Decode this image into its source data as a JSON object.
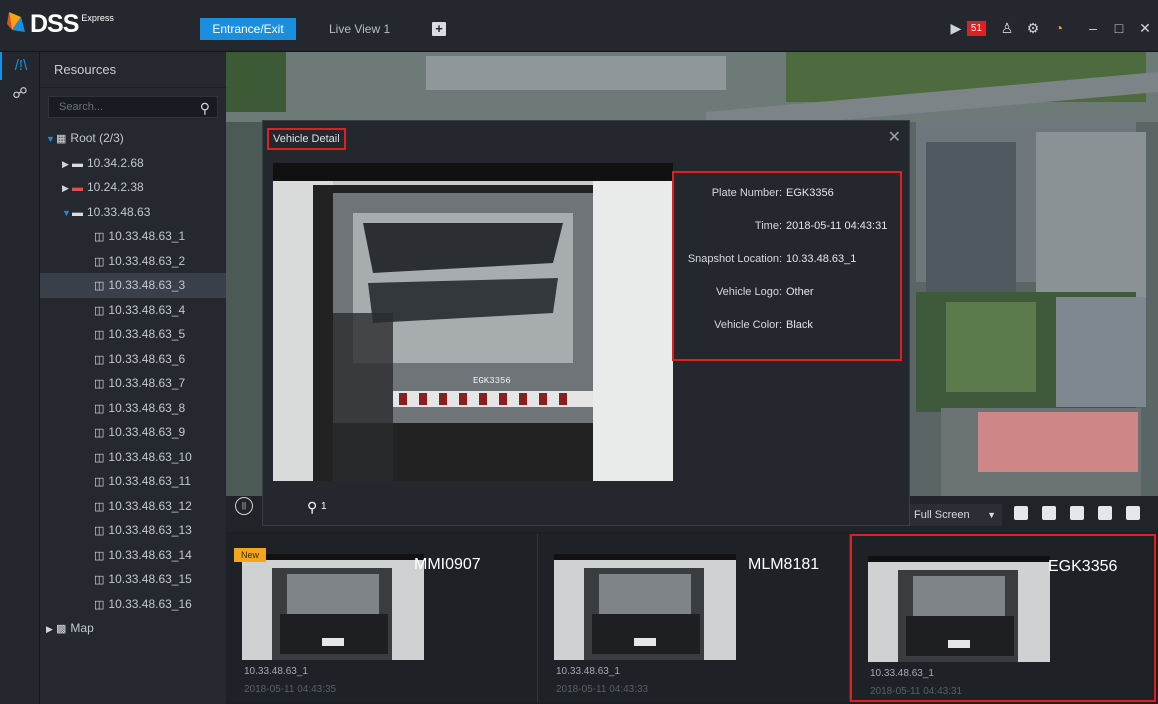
{
  "app": {
    "brand": "DSS",
    "edition": "Express"
  },
  "tabs": [
    {
      "label": "Entrance/Exit"
    },
    {
      "label": "Live View 1"
    }
  ],
  "topbar": {
    "alarm_count": "51"
  },
  "sidebar": {
    "title": "Resources",
    "search_placeholder": "Search...",
    "tree": [
      {
        "label": "Root (2/3)",
        "level": 0,
        "expanded": true,
        "icon": "org-icon"
      },
      {
        "label": "10.34.2.68",
        "level": 1,
        "expanded": false,
        "icon": "device-icon"
      },
      {
        "label": "10.24.2.38",
        "level": 1,
        "expanded": false,
        "icon": "device-offline-icon"
      },
      {
        "label": "10.33.48.63",
        "level": 1,
        "expanded": true,
        "icon": "device-icon"
      },
      {
        "label": "10.33.48.63_1",
        "level": 2,
        "icon": "camera-icon"
      },
      {
        "label": "10.33.48.63_2",
        "level": 2,
        "icon": "camera-icon"
      },
      {
        "label": "10.33.48.63_3",
        "level": 2,
        "icon": "camera-icon",
        "selected": true
      },
      {
        "label": "10.33.48.63_4",
        "level": 2,
        "icon": "camera-icon"
      },
      {
        "label": "10.33.48.63_5",
        "level": 2,
        "icon": "camera-icon"
      },
      {
        "label": "10.33.48.63_6",
        "level": 2,
        "icon": "camera-icon"
      },
      {
        "label": "10.33.48.63_7",
        "level": 2,
        "icon": "camera-icon"
      },
      {
        "label": "10.33.48.63_8",
        "level": 2,
        "icon": "camera-icon"
      },
      {
        "label": "10.33.48.63_9",
        "level": 2,
        "icon": "camera-icon"
      },
      {
        "label": "10.33.48.63_10",
        "level": 2,
        "icon": "camera-icon"
      },
      {
        "label": "10.33.48.63_11",
        "level": 2,
        "icon": "camera-icon"
      },
      {
        "label": "10.33.48.63_12",
        "level": 2,
        "icon": "camera-icon"
      },
      {
        "label": "10.33.48.63_13",
        "level": 2,
        "icon": "camera-icon"
      },
      {
        "label": "10.33.48.63_14",
        "level": 2,
        "icon": "camera-icon"
      },
      {
        "label": "10.33.48.63_15",
        "level": 2,
        "icon": "camera-icon"
      },
      {
        "label": "10.33.48.63_16",
        "level": 2,
        "icon": "camera-icon"
      },
      {
        "label": "Map",
        "level": 0,
        "expanded": false,
        "icon": "map-icon"
      }
    ]
  },
  "dialog": {
    "title": "Vehicle Detail",
    "snapshot_plate_text": "EGK3356",
    "fields": [
      {
        "label": "Plate Number:",
        "value": "EGK3356"
      },
      {
        "label": "Time:",
        "value": "2018-05-11 04:43:31"
      },
      {
        "label": "Snapshot Location:",
        "value": "10.33.48.63_1"
      },
      {
        "label": "Vehicle Logo:",
        "value": "Other"
      },
      {
        "label": "Vehicle Color:",
        "value": "Black"
      }
    ],
    "pin_count": "1"
  },
  "view_controls": {
    "fullscreen_label": "Full Screen"
  },
  "captures": [
    {
      "plate": "MMI0907",
      "location": "10.33.48.63_1",
      "time": "2018-05-11 04:43:35",
      "new": true,
      "new_label": "New",
      "selected": false
    },
    {
      "plate": "MLM8181",
      "location": "10.33.48.63_1",
      "time": "2018-05-11 04:43:33",
      "new": false,
      "selected": false
    },
    {
      "plate": "EGK3356",
      "location": "10.33.48.63_1",
      "time": "2018-05-11 04:43:31",
      "new": false,
      "selected": true
    }
  ],
  "colors": {
    "accent": "#1a8fe0",
    "highlight": "#e02020",
    "new_badge": "#f3a51c"
  }
}
